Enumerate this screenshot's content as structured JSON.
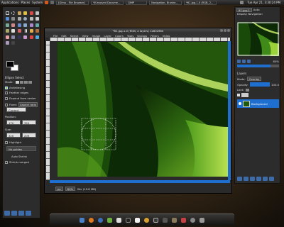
{
  "top_panel": {
    "menus": [
      "Applications",
      "Places",
      "System"
    ],
    "tasks": [
      "[Gimp - File Browser]",
      "*[Unsaved Docume...",
      "GIMP",
      "Navigation, Brushe...",
      "*61.jpg-1.0 (RGB, 2..."
    ],
    "clock": "Tue Apr 21, 3:30:24 PM"
  },
  "toolbox": {
    "tool_options_title": "Ellipse Select",
    "mode_label": "Mode:",
    "antialiasing": "Antialiasing",
    "feather_edges": "Feather edges",
    "expand_from_center": "Expand from center",
    "fixed_label": "Fixed:",
    "fixed_value": "Aspect ratio",
    "fixed_field": "Current",
    "position_label": "Position:",
    "position_x": "170",
    "position_y": "320",
    "size_label": "Size:",
    "size_w": "320",
    "size_h": "209",
    "highlight": "Highlight",
    "guides_value": "No guides",
    "auto_shrink": "Auto Shrink",
    "shrink_merged": "Shrink merged"
  },
  "image_window": {
    "title": "*61.jpg-1.0 (RGB, 2 layers) 1280x960",
    "menus": [
      "File",
      "Edit",
      "Select",
      "View",
      "Image",
      "Layer",
      "Colors",
      "Tools",
      "Dialogs",
      "Filters",
      "Video"
    ],
    "status_unit": "px",
    "status_zoom": "80%",
    "status_info": "Bkr (19.8 MB)"
  },
  "dock": {
    "image_selector": "61.jpg-1",
    "auto_label": "Auto",
    "nav_title": "Display Navigation",
    "zoom_value": "80%",
    "zoom_fraction": 0.8,
    "layers_title": "Layers",
    "mode_label": "Mode:",
    "mode_value": "Overlay",
    "opacity_label": "Opacity:",
    "opacity_value": "100.0",
    "opacity_fraction": 1.0,
    "lock_label": "Lock:",
    "layer_name": "Background"
  },
  "colors": {
    "accent": "#1f6fd0",
    "leaf_dark": "#0d2a06",
    "leaf_light": "#9bd23a"
  }
}
